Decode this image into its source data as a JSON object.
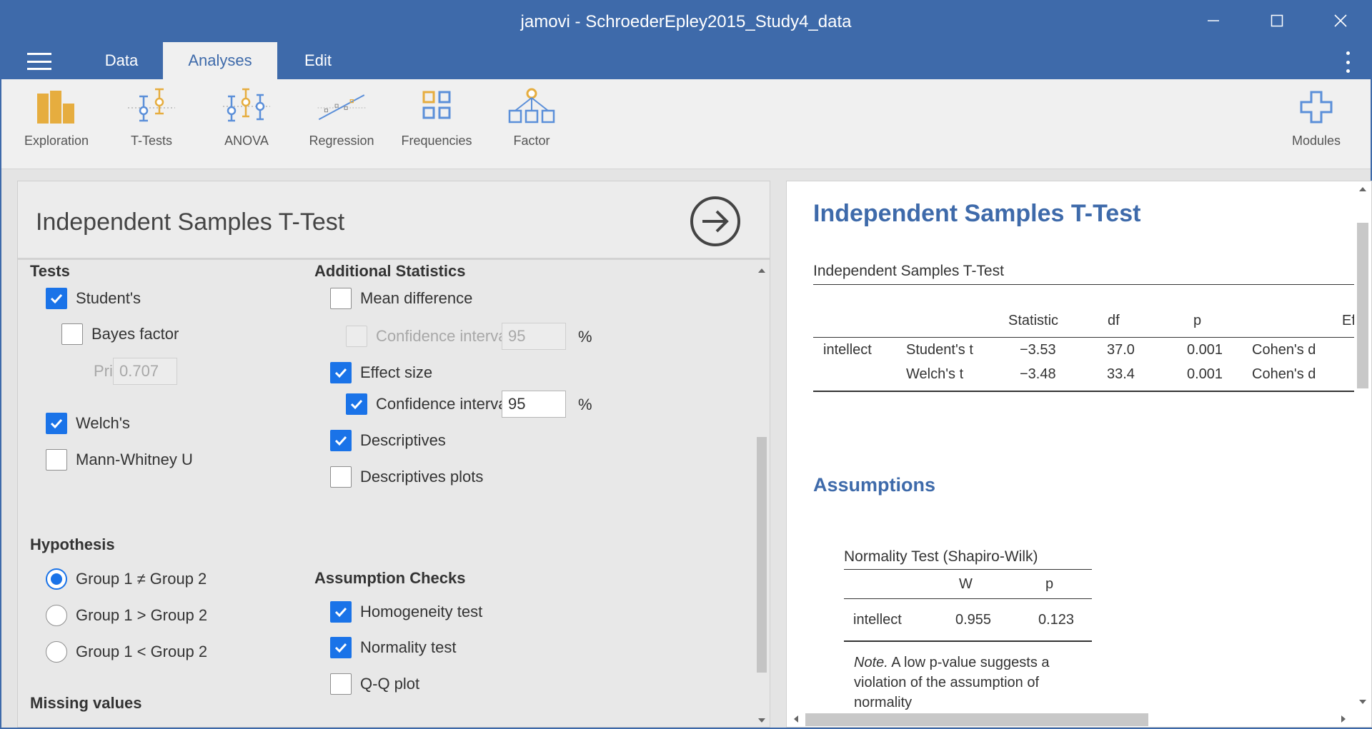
{
  "window": {
    "title": "jamovi - SchroederEpley2015_Study4_data",
    "controls": [
      "minimize-icon",
      "maximize-icon",
      "close-icon"
    ]
  },
  "tabs": [
    {
      "label": "Data"
    },
    {
      "label": "Analyses",
      "active": true
    },
    {
      "label": "Edit"
    }
  ],
  "ribbon": {
    "items": [
      {
        "label": "Exploration",
        "icon": "exploration-icon"
      },
      {
        "label": "T-Tests",
        "icon": "t-tests-icon"
      },
      {
        "label": "ANOVA",
        "icon": "anova-icon"
      },
      {
        "label": "Regression",
        "icon": "regression-icon"
      },
      {
        "label": "Frequencies",
        "icon": "frequencies-icon"
      },
      {
        "label": "Factor",
        "icon": "factor-icon"
      }
    ],
    "modules": {
      "label": "Modules",
      "icon": "plus-icon"
    }
  },
  "options": {
    "title": "Independent Samples T-Test",
    "tests": {
      "heading": "Tests",
      "students": {
        "label": "Student's",
        "checked": true
      },
      "bayes": {
        "label": "Bayes factor",
        "checked": false
      },
      "prior_label": "Prior",
      "prior_value": "0.707",
      "welchs": {
        "label": "Welch's",
        "checked": true
      },
      "mann_whitney": {
        "label": "Mann-Whitney U",
        "checked": false
      }
    },
    "hypothesis": {
      "heading": "Hypothesis",
      "options": [
        {
          "label": "Group 1 ≠ Group 2",
          "selected": true
        },
        {
          "label": "Group 1 > Group 2",
          "selected": false
        },
        {
          "label": "Group 1 < Group 2",
          "selected": false
        }
      ]
    },
    "missing": {
      "heading": "Missing values"
    },
    "additional": {
      "heading": "Additional Statistics",
      "mean_diff": {
        "label": "Mean difference",
        "checked": false
      },
      "mean_diff_ci": {
        "label": "Confidence interval",
        "checked": false,
        "value": "95",
        "unit": "%",
        "disabled": true
      },
      "effect_size": {
        "label": "Effect size",
        "checked": true
      },
      "effect_size_ci": {
        "label": "Confidence interval",
        "checked": true,
        "value": "95",
        "unit": "%"
      },
      "descriptives": {
        "label": "Descriptives",
        "checked": true
      },
      "descriptives_plots": {
        "label": "Descriptives plots",
        "checked": false
      }
    },
    "assumptions": {
      "heading": "Assumption Checks",
      "homogeneity": {
        "label": "Homogeneity test",
        "checked": true
      },
      "normality": {
        "label": "Normality test",
        "checked": true
      },
      "qq": {
        "label": "Q-Q plot",
        "checked": false
      }
    }
  },
  "results": {
    "title": "Independent Samples T-Test",
    "table": {
      "subtitle": "Independent Samples T-Test",
      "headers": [
        "Statistic",
        "df",
        "p",
        "Ef"
      ],
      "rows": [
        {
          "var": "intellect",
          "test": "Student's t",
          "statistic": "−3.53",
          "df": "37.0",
          "p": "0.001",
          "effect": "Cohen's d"
        },
        {
          "var": "",
          "test": "Welch's t",
          "statistic": "−3.48",
          "df": "33.4",
          "p": "0.001",
          "effect": "Cohen's d"
        }
      ]
    },
    "assumptions_heading": "Assumptions",
    "normality": {
      "title": "Normality Test (Shapiro-Wilk)",
      "headers": [
        "W",
        "p"
      ],
      "row": {
        "var": "intellect",
        "W": "0.955",
        "p": "0.123"
      },
      "note_label": "Note.",
      "note_lines": [
        " A low p-value suggests a",
        "violation of the assumption of",
        "normality"
      ]
    }
  },
  "colors": {
    "brand": "#3e6aaa",
    "checkbox": "#1a73e8",
    "ribbon_orange": "#e6ad3f",
    "ribbon_blue": "#5b8fd9"
  }
}
